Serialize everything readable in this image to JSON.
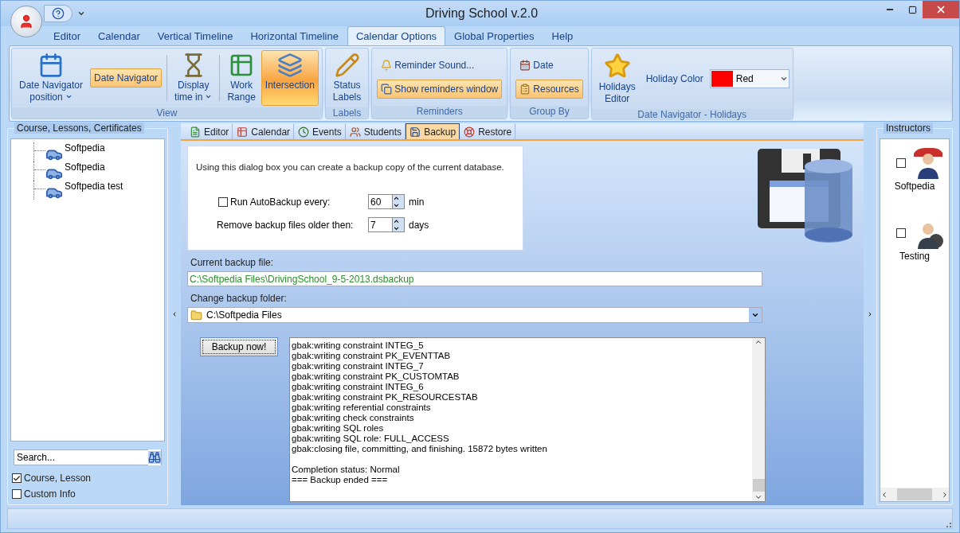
{
  "window": {
    "title": "Driving School v.2.0"
  },
  "menu_tabs": [
    {
      "label": "Editor",
      "selected": false
    },
    {
      "label": "Calendar",
      "selected": false
    },
    {
      "label": "Vertical Timeline",
      "selected": false
    },
    {
      "label": "Horizontal Timeline",
      "selected": false
    },
    {
      "label": "Calendar Options",
      "selected": true
    },
    {
      "label": "Global Properties",
      "selected": false
    },
    {
      "label": "Help",
      "selected": false
    }
  ],
  "ribbon_groups": [
    {
      "title": "View",
      "items": [
        {
          "kind": "large",
          "label": "Date Navigator\nposition",
          "dropdown": true,
          "selected": false
        },
        {
          "kind": "small",
          "label": "Date Navigator",
          "selected": true
        },
        {
          "kind": "large",
          "label": "Display\ntime in",
          "dropdown": true,
          "selected": false,
          "separator_before": true
        },
        {
          "kind": "large",
          "label": "Work\nRange",
          "selected": false,
          "separator_before": true
        },
        {
          "kind": "large",
          "label": "Intersection",
          "selected": true
        }
      ]
    },
    {
      "title": "Labels",
      "items": [
        {
          "kind": "large",
          "label": "Status\nLabels",
          "selected": false
        }
      ]
    },
    {
      "title": "Reminders",
      "items": [
        {
          "kind": "small",
          "label": "Reminder Sound...",
          "selected": false
        },
        {
          "kind": "small",
          "label": "Show reminders window",
          "selected": true
        }
      ]
    },
    {
      "title": "Group By",
      "items": [
        {
          "kind": "small",
          "label": "Date",
          "selected": false
        },
        {
          "kind": "small",
          "label": "Resources",
          "selected": true
        }
      ]
    },
    {
      "title": "Date Navigator - Holidays",
      "items": [
        {
          "kind": "large",
          "label": "Holidays\nEditor",
          "selected": false
        },
        {
          "kind": "color",
          "label": "Holiday Color",
          "value": "Red",
          "color": "#ff0000"
        }
      ]
    }
  ],
  "left_panel": {
    "title": "Course, Lessons, Certificates",
    "tree": [
      {
        "label": "Softpedia"
      },
      {
        "label": "Softpedia"
      },
      {
        "label": "Softpedia test"
      }
    ],
    "search": {
      "placeholder": "Search..."
    },
    "options": [
      {
        "label": "Course, Lesson",
        "checked": true
      },
      {
        "label": "Custom Info",
        "checked": false
      }
    ]
  },
  "content_tabs": [
    {
      "label": "Editor",
      "selected": false
    },
    {
      "label": "Calendar",
      "selected": false
    },
    {
      "label": "Events",
      "selected": false
    },
    {
      "label": "Students",
      "selected": false
    },
    {
      "label": "Backup",
      "selected": true
    },
    {
      "label": "Restore",
      "selected": false
    }
  ],
  "backup": {
    "description": "Using this dialog box you can create a backup copy of the current database.",
    "auto": {
      "label": "Run AutoBackup every:",
      "checked": false,
      "value": "60",
      "unit": "min"
    },
    "remove": {
      "label": "Remove backup files older then:",
      "value": "7",
      "unit": "days"
    },
    "current_file": {
      "label": "Current backup file:",
      "value": "C:\\Softpedia Files\\DrivingSchool_9-5-2013.dsbackup"
    },
    "folder": {
      "label": "Change backup folder:",
      "value": "C:\\Softpedia Files"
    },
    "button": "Backup now!",
    "log": [
      {
        "lines": [
          "gbak:writing constraint INTEG_5",
          "gbak:writing constraint PK_EVENTTAB",
          "gbak:writing constraint INTEG_7",
          "gbak:writing constraint PK_CUSTOMTAB",
          "gbak:writing constraint INTEG_6",
          "gbak:writing constraint PK_RESOURCESTAB",
          "gbak:writing referential constraints",
          "gbak:writing check constraints",
          "gbak:writing SQL roles",
          "gbak:writing SQL role: FULL_ACCESS",
          "gbak:closing file, committing, and finishing. 15872 bytes written"
        ]
      },
      {
        "lines": [
          "Completion status: Normal",
          "=== Backup ended ==="
        ]
      }
    ]
  },
  "instructors": {
    "title": "Instructors",
    "items": [
      {
        "name": "Softpedia",
        "checked": false
      },
      {
        "name": "Testing",
        "checked": false
      }
    ]
  }
}
